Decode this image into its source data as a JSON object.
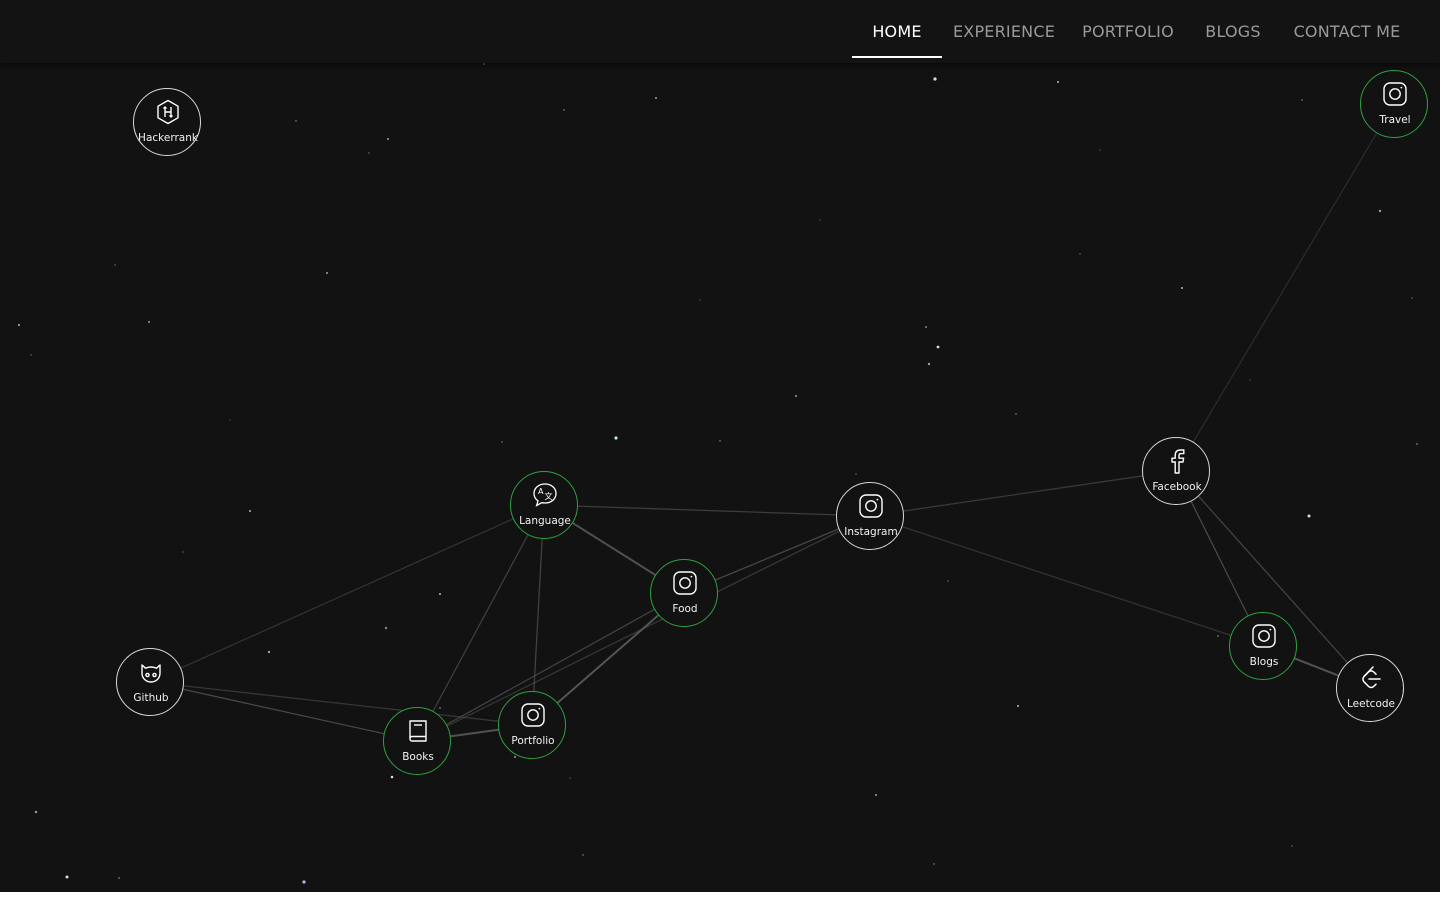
{
  "nav": {
    "items": [
      {
        "label": "HOME",
        "active": true
      },
      {
        "label": "EXPERIENCE",
        "active": false
      },
      {
        "label": "PORTFOLIO",
        "active": false
      },
      {
        "label": "BLOGS",
        "active": false
      },
      {
        "label": "CONTACT ME",
        "active": false
      }
    ]
  },
  "graph": {
    "nodes": [
      {
        "id": "hackerrank",
        "label": "Hackerrank",
        "icon": "hackerrank-icon",
        "highlight": false
      },
      {
        "id": "travel",
        "label": "Travel",
        "icon": "instagram-icon",
        "highlight": true
      },
      {
        "id": "language",
        "label": "Language",
        "icon": "translate-icon",
        "highlight": true
      },
      {
        "id": "instagram",
        "label": "Instagram",
        "icon": "instagram-icon",
        "highlight": false
      },
      {
        "id": "facebook",
        "label": "Facebook",
        "icon": "facebook-icon",
        "highlight": false
      },
      {
        "id": "food",
        "label": "Food",
        "icon": "instagram-icon",
        "highlight": true
      },
      {
        "id": "blogs",
        "label": "Blogs",
        "icon": "instagram-icon",
        "highlight": true
      },
      {
        "id": "github",
        "label": "Github",
        "icon": "github-icon",
        "highlight": false
      },
      {
        "id": "leetcode",
        "label": "Leetcode",
        "icon": "leetcode-icon",
        "highlight": false
      },
      {
        "id": "portfolio",
        "label": "Portfolio",
        "icon": "instagram-icon",
        "highlight": true
      },
      {
        "id": "books",
        "label": "Books",
        "icon": "book-icon",
        "highlight": true
      }
    ]
  },
  "colors": {
    "background": "#121212",
    "navbar": "#131313",
    "node_border": "#d9d9d9",
    "highlight_border": "#2ea043",
    "link": "#5a5a5a"
  }
}
